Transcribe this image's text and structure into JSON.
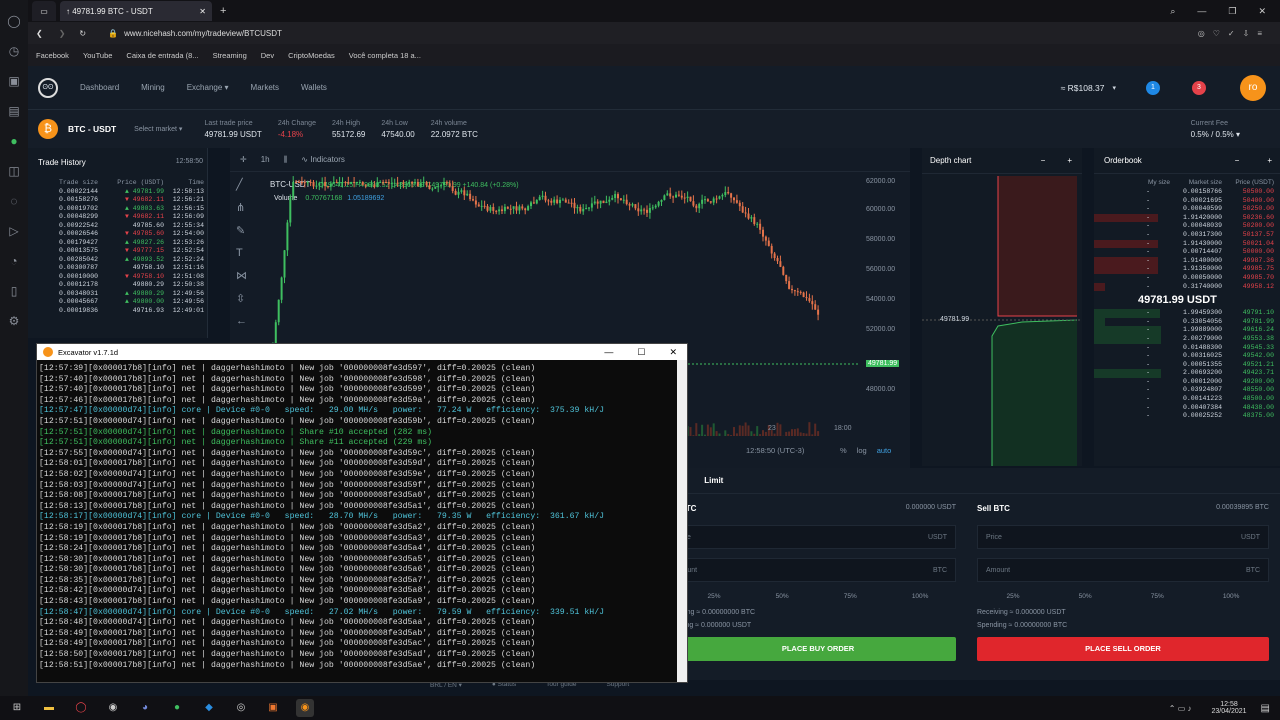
{
  "browser": {
    "tab_title": "↑ 49781.99 BTC - USDT",
    "url": "www.nicehash.com/my/tradeview/BTCUSDT",
    "bookmarks": [
      "Facebook",
      "YouTube",
      "Caixa de entrada (8...",
      "Streaming",
      "Dev",
      "CriptoMoedas",
      "Você completa 18 a..."
    ]
  },
  "nav": {
    "items": [
      "Dashboard",
      "Mining",
      "Exchange ▾",
      "Markets",
      "Wallets"
    ],
    "balance": "≈ R$108.37",
    "badge1": "1",
    "badge2": "3",
    "avatar": "ro"
  },
  "market": {
    "pair": "BTC - USDT",
    "select": "Select market ▾",
    "stats": [
      {
        "l": "Last trade price",
        "v": "49781.99 USDT"
      },
      {
        "l": "24h Change",
        "v": "-4.18%"
      },
      {
        "l": "24h High",
        "v": "55172.69"
      },
      {
        "l": "24h Low",
        "v": "47540.00"
      },
      {
        "l": "24h volume",
        "v": "22.0972 BTC"
      }
    ],
    "fee_label": "Current Fee",
    "fee_value": "0.5% / 0.5% ▾"
  },
  "trade_history": {
    "title": "Trade History",
    "time": "12:58:50",
    "headers": [
      "Trade size",
      "Price (USDT)",
      "Time"
    ],
    "rows": [
      [
        "0.00022144",
        "▲ 49781.99",
        "12:58:13",
        "up"
      ],
      [
        "0.00158276",
        "▼ 49682.11",
        "12:56:21",
        "down"
      ],
      [
        "0.00019702",
        "▲ 49803.63",
        "12:56:15",
        "up"
      ],
      [
        "0.00048299",
        "▼ 49682.11",
        "12:56:09",
        "down"
      ],
      [
        "0.00922542",
        "49785.60",
        "12:55:34",
        "flat"
      ],
      [
        "0.00026546",
        "▼ 49785.60",
        "12:54:00",
        "down"
      ],
      [
        "0.00179427",
        "▲ 49827.26",
        "12:53:26",
        "up"
      ],
      [
        "0.00013575",
        "▼ 49777.15",
        "12:52:54",
        "down"
      ],
      [
        "0.00285042",
        "▲ 49893.52",
        "12:52:24",
        "up"
      ],
      [
        "0.00300787",
        "49758.10",
        "12:51:16",
        "flat"
      ],
      [
        "0.00010000",
        "▼ 49758.10",
        "12:51:08",
        "down"
      ],
      [
        "0.00012178",
        "49880.29",
        "12:50:38",
        "flat"
      ],
      [
        "0.00348031",
        "▲ 49880.29",
        "12:49:56",
        "up"
      ],
      [
        "0.00045667",
        "▲ 49800.00",
        "12:49:56",
        "up"
      ],
      [
        "0.00019836",
        "49716.93",
        "12:49:01",
        "flat"
      ]
    ]
  },
  "chart": {
    "interval": "1h",
    "indicators": "Indicators",
    "symbol": "BTC-USDT",
    "ohlc": "O49641.15 H49893.52 L48965.69 C49781.99 +140.84 (+0.28%)",
    "volume_label": "Volume",
    "vol1": "0.70767168",
    "vol2": "1.05189692",
    "y_ticks": [
      "62000.00",
      "60000.00",
      "58000.00",
      "56000.00",
      "54000.00",
      "52000.00",
      "49781.99",
      "48000.00"
    ],
    "x_ticks": [
      "23",
      "18:00"
    ],
    "clock": "12:58:50 (UTC-3)",
    "bottom": [
      "%",
      "log",
      "auto"
    ]
  },
  "depth": {
    "title": "Depth chart",
    "price": "49781.99"
  },
  "orderbook": {
    "title": "Orderbook",
    "headers": [
      "My size",
      "Market size",
      "Price (USDT)"
    ],
    "mid": "49781.99 USDT",
    "asks": [
      [
        "0.00158766",
        "50500.00"
      ],
      [
        "0.00021695",
        "50400.00"
      ],
      [
        "0.00040599",
        "50250.00"
      ],
      [
        "1.91420000",
        "50236.60"
      ],
      [
        "0.00048039",
        "50200.00"
      ],
      [
        "0.00317300",
        "50137.57"
      ],
      [
        "1.91430000",
        "50021.04"
      ],
      [
        "0.00714407",
        "50000.00"
      ],
      [
        "1.91400000",
        "49987.36"
      ],
      [
        "1.91350000",
        "49985.75"
      ],
      [
        "0.00050000",
        "49985.70"
      ],
      [
        "0.31740000",
        "49958.12"
      ]
    ],
    "bids": [
      [
        "1.99459300",
        "49791.10"
      ],
      [
        "0.33054056",
        "49781.99"
      ],
      [
        "1.99889000",
        "49616.24"
      ],
      [
        "2.00279000",
        "49553.38"
      ],
      [
        "0.01488300",
        "49545.33"
      ],
      [
        "0.00316025",
        "49542.00"
      ],
      [
        "0.00051355",
        "49521.21"
      ],
      [
        "2.00693200",
        "49423.71"
      ],
      [
        "0.00012000",
        "49200.00"
      ],
      [
        "0.03924807",
        "48550.00"
      ],
      [
        "0.00141223",
        "48500.00"
      ],
      [
        "0.00407384",
        "48438.00"
      ],
      [
        "0.00025252",
        "48375.00"
      ]
    ]
  },
  "trade": {
    "tab_market": "t",
    "tab_limit": "Limit",
    "buy_title": "BTC",
    "buy_balance": "0.000000 USDT",
    "sell_title": "Sell BTC",
    "sell_balance": "0.00039895 BTC",
    "price": "Price",
    "amount": "Amount",
    "usdt": "USDT",
    "btc": "BTC",
    "pcts": [
      "25%",
      "50%",
      "75%",
      "100%"
    ],
    "buy_recv": "iving ≈ 0.00000000 BTC",
    "buy_spend": "ding ≈ 0.000000 USDT",
    "sell_recv": "Receiving ≈ 0.000000 USDT",
    "sell_spend": "Spending ≈ 0.00000000 BTC",
    "buy_btn": "PLACE BUY ORDER",
    "sell_btn": "PLACE SELL ORDER",
    "footer": [
      "BRL / EN ▾",
      "● Status",
      "Tour guide",
      "Support"
    ]
  },
  "terminal": {
    "title": "Excavator v1.7.1d",
    "lines": [
      [
        "[12:57:39][0x000017b8][info] net | daggerhashimoto | New job '000000008fe3d597', diff=0.20025 (clean)",
        "n"
      ],
      [
        "[12:57:40][0x000017b8][info] net | daggerhashimoto | New job '000000008fe3d598', diff=0.20025 (clean)",
        "n"
      ],
      [
        "[12:57:40][0x000017b8][info] net | daggerhashimoto | New job '000000008fe3d599', diff=0.20025 (clean)",
        "n"
      ],
      [
        "[12:57:46][0x000017b8][info] net | daggerhashimoto | New job '000000008fe3d59a', diff=0.20025 (clean)",
        "n"
      ],
      [
        "[12:57:47][0x00000d74][info] core | Device #0-0   speed:   29.00 MH/s   power:   77.24 W   efficiency:  375.39 kH/J",
        "c"
      ],
      [
        "[12:57:51][0x00000d74][info] net | daggerhashimoto | New job '000000008fe3d59b', diff=0.20025 (clean)",
        "n"
      ],
      [
        "[12:57:51][0x00000d74][info] net | daggerhashimoto | Share #10 accepted (282 ms)",
        "g"
      ],
      [
        "[12:57:51][0x00000d74][info] net | daggerhashimoto | Share #11 accepted (229 ms)",
        "g"
      ],
      [
        "[12:57:55][0x00000d74][info] net | daggerhashimoto | New job '000000008fe3d59c', diff=0.20025 (clean)",
        "n"
      ],
      [
        "[12:58:01][0x000017b8][info] net | daggerhashimoto | New job '000000008fe3d59d', diff=0.20025 (clean)",
        "n"
      ],
      [
        "[12:58:02][0x00000d74][info] net | daggerhashimoto | New job '000000008fe3d59e', diff=0.20025 (clean)",
        "n"
      ],
      [
        "[12:58:03][0x00000d74][info] net | daggerhashimoto | New job '000000008fe3d59f', diff=0.20025 (clean)",
        "n"
      ],
      [
        "[12:58:08][0x000017b8][info] net | daggerhashimoto | New job '000000008fe3d5a0', diff=0.20025 (clean)",
        "n"
      ],
      [
        "[12:58:13][0x000017b8][info] net | daggerhashimoto | New job '000000008fe3d5a1', diff=0.20025 (clean)",
        "n"
      ],
      [
        "[12:58:17][0x00000d74][info] core | Device #0-0   speed:   28.70 MH/s   power:   79.35 W   efficiency:  361.67 kH/J",
        "c"
      ],
      [
        "[12:58:19][0x000017b8][info] net | daggerhashimoto | New job '000000008fe3d5a2', diff=0.20025 (clean)",
        "n"
      ],
      [
        "[12:58:19][0x000017b8][info] net | daggerhashimoto | New job '000000008fe3d5a3', diff=0.20025 (clean)",
        "n"
      ],
      [
        "[12:58:24][0x000017b8][info] net | daggerhashimoto | New job '000000008fe3d5a4', diff=0.20025 (clean)",
        "n"
      ],
      [
        "[12:58:30][0x000017b8][info] net | daggerhashimoto | New job '000000008fe3d5a5', diff=0.20025 (clean)",
        "n"
      ],
      [
        "[12:58:30][0x000017b8][info] net | daggerhashimoto | New job '000000008fe3d5a6', diff=0.20025 (clean)",
        "n"
      ],
      [
        "[12:58:35][0x000017b8][info] net | daggerhashimoto | New job '000000008fe3d5a7', diff=0.20025 (clean)",
        "n"
      ],
      [
        "[12:58:42][0x00000d74][info] net | daggerhashimoto | New job '000000008fe3d5a8', diff=0.20025 (clean)",
        "n"
      ],
      [
        "[12:58:43][0x000017b8][info] net | daggerhashimoto | New job '000000008fe3d5a9', diff=0.20025 (clean)",
        "n"
      ],
      [
        "[12:58:47][0x00000d74][info] core | Device #0-0   speed:   27.02 MH/s   power:   79.59 W   efficiency:  339.51 kH/J",
        "c"
      ],
      [
        "[12:58:48][0x00000d74][info] net | daggerhashimoto | New job '000000008fe3d5aa', diff=0.20025 (clean)",
        "n"
      ],
      [
        "[12:58:49][0x000017b8][info] net | daggerhashimoto | New job '000000008fe3d5ab', diff=0.20025 (clean)",
        "n"
      ],
      [
        "[12:58:49][0x000017b8][info] net | daggerhashimoto | New job '000000008fe3d5ac', diff=0.20025 (clean)",
        "n"
      ],
      [
        "[12:58:50][0x000017b8][info] net | daggerhashimoto | New job '000000008fe3d5ad', diff=0.20025 (clean)",
        "n"
      ],
      [
        "[12:58:51][0x000017b8][info] net | daggerhashimoto | New job '000000008fe3d5ae', diff=0.20025 (clean)",
        "n"
      ]
    ]
  },
  "taskbar": {
    "time": "12:58",
    "date": "23/04/2021"
  },
  "colors": {
    "up": "#3fbf60",
    "down": "#e5424a",
    "accent": "#f7931a"
  }
}
